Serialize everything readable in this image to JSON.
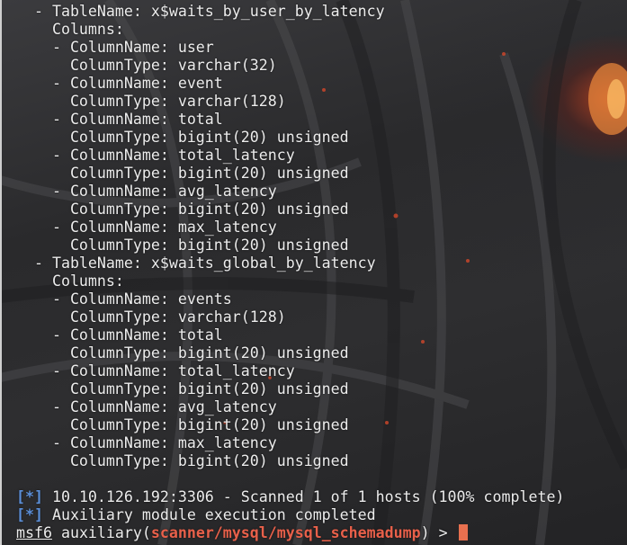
{
  "terminal": {
    "lines": [
      "  - TableName: x$waits_by_user_by_latency",
      "    Columns:",
      "    - ColumnName: user",
      "      ColumnType: varchar(32)",
      "    - ColumnName: event",
      "      ColumnType: varchar(128)",
      "    - ColumnName: total",
      "      ColumnType: bigint(20) unsigned",
      "    - ColumnName: total_latency",
      "      ColumnType: bigint(20) unsigned",
      "    - ColumnName: avg_latency",
      "      ColumnType: bigint(20) unsigned",
      "    - ColumnName: max_latency",
      "      ColumnType: bigint(20) unsigned",
      "  - TableName: x$waits_global_by_latency",
      "    Columns:",
      "    - ColumnName: events",
      "      ColumnType: varchar(128)",
      "    - ColumnName: total",
      "      ColumnType: bigint(20) unsigned",
      "    - ColumnName: total_latency",
      "      ColumnType: bigint(20) unsigned",
      "    - ColumnName: avg_latency",
      "      ColumnType: bigint(20) unsigned",
      "    - ColumnName: max_latency",
      "      ColumnType: bigint(20) unsigned"
    ],
    "status": [
      {
        "marker": "[*]",
        "text": " 10.10.126.192:3306 - Scanned 1 of 1 hosts (100% complete)"
      },
      {
        "marker": "[*]",
        "text": " Auxiliary module execution completed"
      }
    ],
    "prompt": {
      "user": "msf6",
      "prefix": " auxiliary(",
      "module": "scanner/mysql/mysql_schemadump",
      "suffix": ") > "
    }
  },
  "colors": {
    "status_marker": "#5b8fd9",
    "module": "#e8604a",
    "cursor": "#e8704f"
  }
}
